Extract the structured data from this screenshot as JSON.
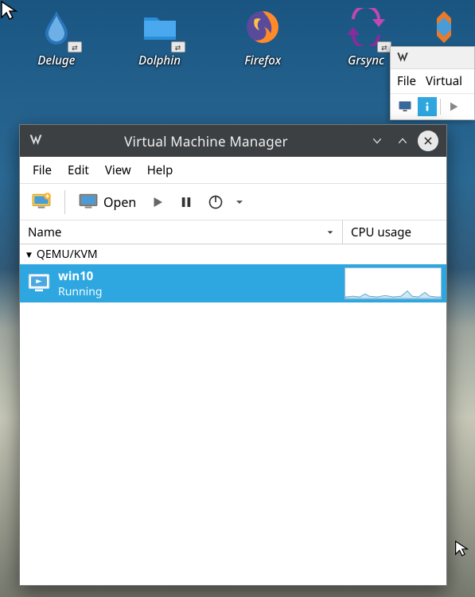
{
  "desktop": {
    "icons": [
      {
        "label": "Deluge",
        "icon": "deluge-icon"
      },
      {
        "label": "Dolphin",
        "icon": "dolphin-icon"
      },
      {
        "label": "Firefox",
        "icon": "firefox-icon"
      },
      {
        "label": "Grsync",
        "icon": "grsync-icon"
      }
    ]
  },
  "secondary_window": {
    "menu": [
      "File",
      "Virtual"
    ]
  },
  "window": {
    "title": "Virtual Machine Manager",
    "menus": [
      "File",
      "Edit",
      "View",
      "Help"
    ],
    "toolbar": {
      "open_label": "Open"
    },
    "columns": {
      "name": "Name",
      "cpu": "CPU usage"
    },
    "connection": {
      "label": "QEMU/KVM"
    },
    "vm": {
      "name": "win10",
      "state": "Running"
    }
  }
}
